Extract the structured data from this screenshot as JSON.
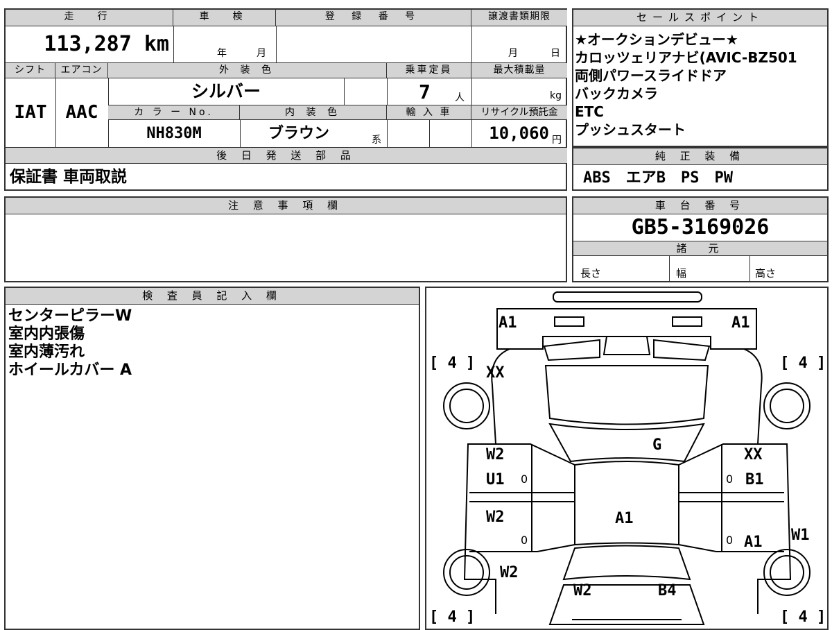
{
  "summary": {
    "mileage_label": "走　行",
    "mileage_value": "113,287 km",
    "inspection_label": "車　検",
    "inspection_year": "年",
    "inspection_month": "月",
    "registration_label": "登 録 番 号",
    "transfer_label": "譲渡書類期限",
    "transfer_month": "月",
    "transfer_day": "日",
    "shift_label": "シフト",
    "shift_value": "IAT",
    "ac_label": "エアコン",
    "ac_value": "AAC",
    "exterior_label": "外 装 色",
    "exterior_value": "シルバー",
    "capacity_label": "乗車定員",
    "capacity_value": "7",
    "capacity_unit": "人",
    "load_label": "最大積載量",
    "load_unit": "kg",
    "color_no_label": "カ ラ ー No.",
    "color_no_value": "NH830M",
    "interior_label": "内 装 色",
    "interior_value": "ブラウン",
    "interior_suffix": "系",
    "import_label": "輸 入 車",
    "recycle_label": "リサイクル預託金",
    "recycle_value": "10,060",
    "recycle_unit": "円",
    "later_parts_label": "後 日 発 送 部 品",
    "later_parts_value": "保証書 車両取説"
  },
  "sales": {
    "label": "セールスポイント",
    "lines": [
      "★オークションデビュー★",
      "カロッツェリアナビ(AVIC-BZ501",
      "両側パワースライドドア",
      "バックカメラ",
      "ETC",
      "プッシュスタート"
    ]
  },
  "equipment": {
    "label": "純 正 装 備",
    "value": "ABS　エアB　PS　PW"
  },
  "notes": {
    "label": "注 意 事 項 欄"
  },
  "chassis": {
    "label": "車 台 番 号",
    "value": "GB5-3169026",
    "spec_label": "諸　元",
    "length_label": "長さ",
    "width_label": "幅",
    "height_label": "高さ"
  },
  "inspector": {
    "label": "検 査 員 記 入 欄",
    "lines": [
      "センターピラーW",
      "室内内張傷",
      "室内薄汚れ",
      "ホイールカバー A"
    ]
  },
  "diagram": {
    "marks": {
      "front_left": "A1",
      "front_right": "A1",
      "fl_tire": "[ 4 ]",
      "fr_tire": "[ 4 ]",
      "rl_tire": "[ 4 ]",
      "rr_tire": "[ 4 ]",
      "left_fender": "XX",
      "right_fender": "XX",
      "roof_glass": "G",
      "left_front_door_1": "W2",
      "left_front_door_2": "U1",
      "right_front_door": "B1",
      "left_rear_door": "W2",
      "right_rear_door": "A1",
      "roof": "A1",
      "left_quarter": "W2",
      "right_quarter": "W1",
      "rear_left": "W2",
      "rear_right": "B4",
      "zero": "0"
    }
  }
}
